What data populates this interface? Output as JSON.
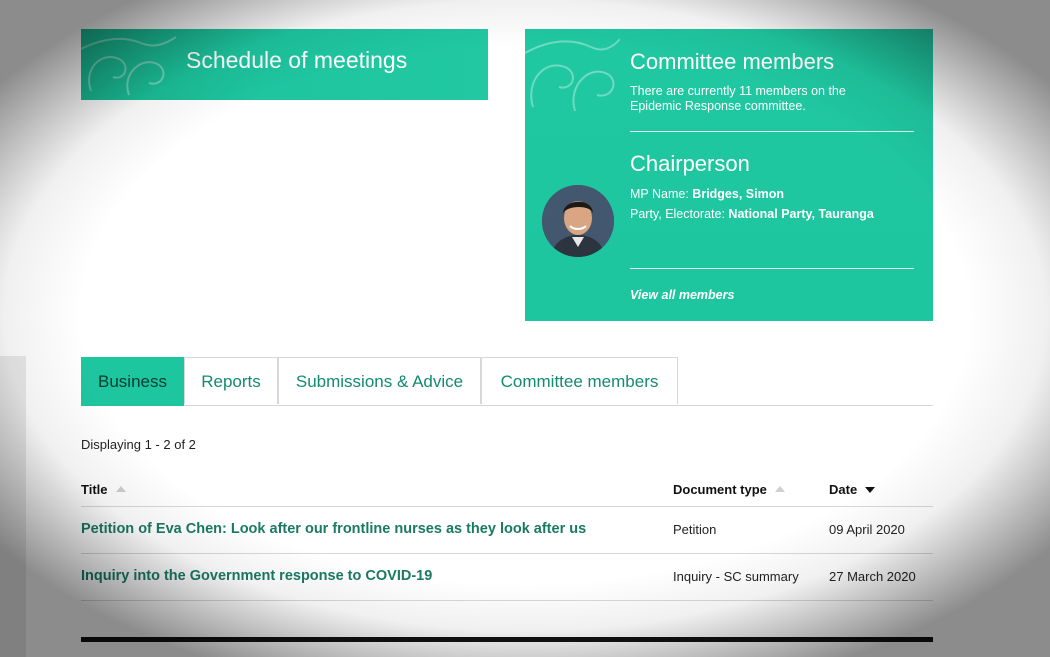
{
  "schedule": {
    "title": "Schedule of meetings"
  },
  "members": {
    "title": "Committee members",
    "description": "There are currently 11 members on the Epidemic Response committee.",
    "chair_heading": "Chairperson",
    "mp_name_label": "MP Name: ",
    "mp_name_value": "Bridges, Simon",
    "party_label": "Party, Electorate: ",
    "party_value": "National Party, Tauranga",
    "view_all": "View all members"
  },
  "tabs": [
    {
      "label": "Business",
      "active": true
    },
    {
      "label": "Reports"
    },
    {
      "label": "Submissions & Advice"
    },
    {
      "label": "Committee members"
    }
  ],
  "listing": {
    "displaying": "Displaying 1 - 2 of 2",
    "columns": {
      "title": "Title",
      "doc_type": "Document type",
      "date": "Date"
    },
    "rows": [
      {
        "title": "Petition of Eva Chen: Look after our frontline nurses as they look after us",
        "type": "Petition",
        "date": "09 April 2020"
      },
      {
        "title": "Inquiry into the Government response to COVID-19",
        "type": "Inquiry - SC summary",
        "date": "27 March 2020"
      }
    ]
  },
  "colors": {
    "accent": "#1ec6a0",
    "link": "#1a7a64",
    "tab_text": "#148a71"
  }
}
